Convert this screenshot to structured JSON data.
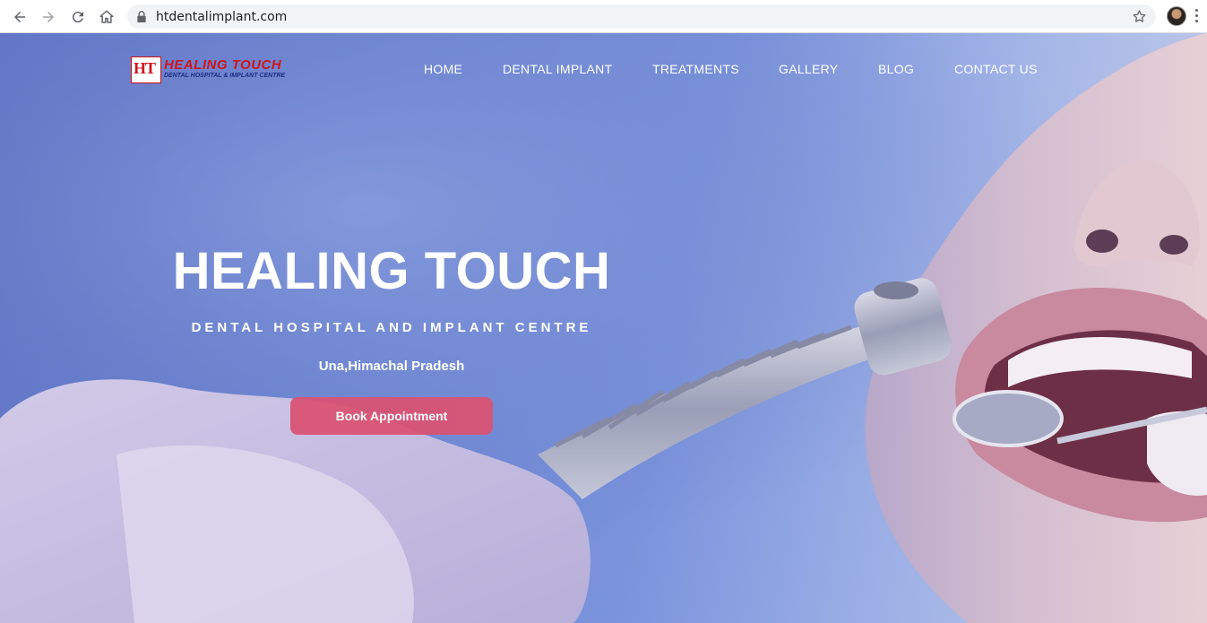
{
  "browser": {
    "url": "htdentalimplant.com"
  },
  "site": {
    "logo_badge": "HT",
    "logo_title": "HEALING TOUCH",
    "logo_subtitle": "DENTAL HOSPITAL & IMPLANT CENTRE"
  },
  "nav": {
    "items": [
      {
        "label": "HOME"
      },
      {
        "label": "DENTAL IMPLANT"
      },
      {
        "label": "TREATMENTS"
      },
      {
        "label": "GALLERY"
      },
      {
        "label": "BLOG"
      },
      {
        "label": "CONTACT US"
      }
    ]
  },
  "hero": {
    "title": "HEALING TOUCH",
    "subtitle": "DENTAL HOSPITAL AND IMPLANT CENTRE",
    "location": "Una,Himachal Pradesh",
    "cta_label": "Book Appointment"
  },
  "colors": {
    "cta": "#d95474",
    "logo_red": "#d0141c",
    "logo_blue": "#1c2d82",
    "overlay_blue": "#6e86d3"
  }
}
